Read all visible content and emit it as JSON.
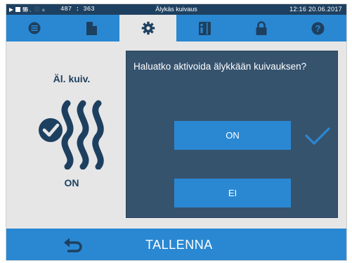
{
  "statusbar": {
    "coords": "487 : 363",
    "title": "Älykäs kuivaus",
    "time": "12:16  20.06.2017",
    "icons": [
      "play-icon",
      "document-icon",
      "drying-icon",
      "chart-icon",
      "info-icon",
      "lock-icon"
    ]
  },
  "nav": {
    "tabs": [
      "menu-list-icon",
      "document-icon",
      "gear-icon",
      "info-book-icon",
      "lock-icon",
      "help-icon"
    ],
    "active_tab": "gear-icon"
  },
  "feature": {
    "title": "Äl. kuiv.",
    "state": "ON",
    "icon": "smart-drying-icon"
  },
  "dialog": {
    "question": "Haluatko aktivoida älykkään kuivauksen?",
    "on_label": "ON",
    "no_label": "EI",
    "selected": "ON"
  },
  "bottom": {
    "save_label": "TALLENNA",
    "back_icon": "back-arrow-icon"
  },
  "colors": {
    "status_bar": "#1e4060",
    "nav_bar": "#2a88d2",
    "dialog_bg": "#36536e",
    "accent": "#2a88d2",
    "check": "#2a88d2",
    "background": "#e6e6e6"
  }
}
